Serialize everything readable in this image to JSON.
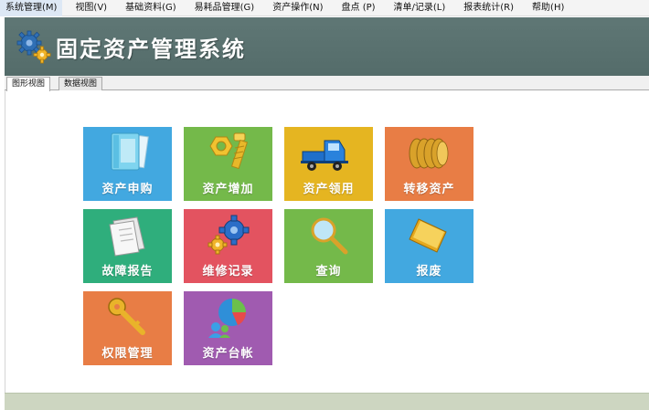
{
  "menu": [
    {
      "id": "system",
      "label": "系统管理(M)"
    },
    {
      "id": "view",
      "label": "视图(V)"
    },
    {
      "id": "basic",
      "label": "基础资料(G)"
    },
    {
      "id": "consumables",
      "label": "易耗品管理(G)"
    },
    {
      "id": "asset-ops",
      "label": "资产操作(N)"
    },
    {
      "id": "inventory",
      "label": "盘点 (P)"
    },
    {
      "id": "records",
      "label": "清单/记录(L)"
    },
    {
      "id": "reports",
      "label": "报表统计(R)"
    },
    {
      "id": "help",
      "label": "帮助(H)"
    }
  ],
  "header": {
    "title": "固定资产管理系统",
    "logo_icon": "gears-icon"
  },
  "tabs": [
    {
      "label": "图形视图",
      "active": true
    },
    {
      "label": "数据视图",
      "active": false
    }
  ],
  "tiles": [
    {
      "label": "资产申购",
      "icon": "document-icon",
      "color": "#42a8e0"
    },
    {
      "label": "资产增加",
      "icon": "bolt-nut-icon",
      "color": "#74b94a"
    },
    {
      "label": "资产领用",
      "icon": "truck-icon",
      "color": "#e5b521"
    },
    {
      "label": "转移资产",
      "icon": "coins-icon",
      "color": "#e87d45"
    },
    {
      "label": "故障报告",
      "icon": "papers-icon",
      "color": "#2fae7c"
    },
    {
      "label": "维修记录",
      "icon": "gears-icon",
      "color": "#e35360"
    },
    {
      "label": "查询",
      "icon": "magnifier-icon",
      "color": "#74b94a"
    },
    {
      "label": "报废",
      "icon": "folder-icon",
      "color": "#42a8e0"
    },
    {
      "label": "权限管理",
      "icon": "key-icon",
      "color": "#e87d45"
    },
    {
      "label": "资产台帐",
      "icon": "pie-chart-users-icon",
      "color": "#a05bb0"
    }
  ]
}
